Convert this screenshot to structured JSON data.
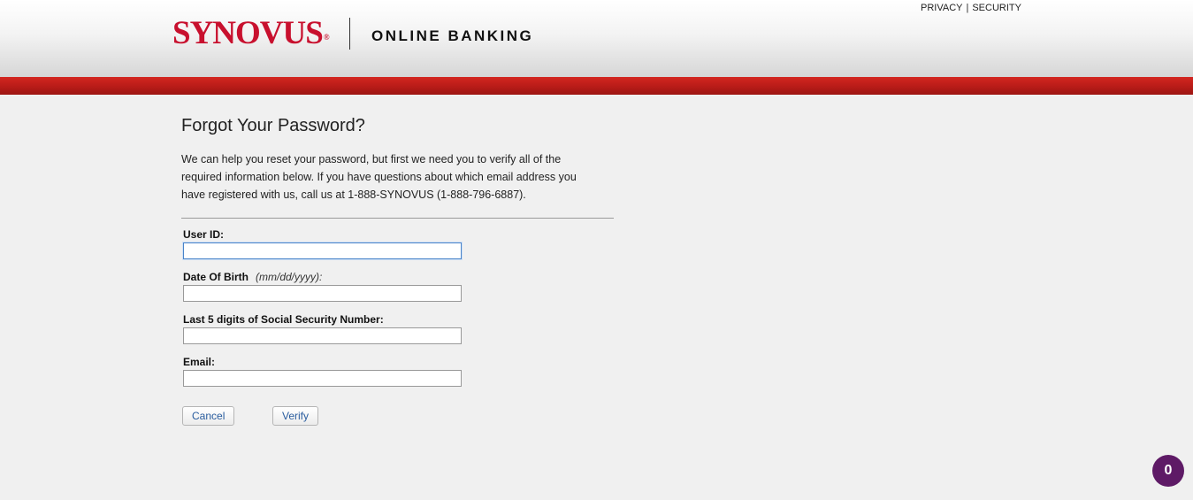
{
  "header": {
    "brand": "SYNOVUS",
    "brand_mark": "®",
    "product": "ONLINE BANKING",
    "links": {
      "privacy": "PRIVACY",
      "separator": "|",
      "security": "SECURITY"
    }
  },
  "colors": {
    "brand_red": "#c8102e",
    "bar_red": "#b81c18",
    "button_text": "#2a5d9f",
    "badge": "#5e1a66"
  },
  "form": {
    "title": "Forgot Your Password?",
    "intro": "We can help you reset your password, but first we need you to verify all of the required information below. If you have questions about which email address you have registered with us, call us at 1-888-SYNOVUS (1-888-796-6887).",
    "fields": {
      "user_id": {
        "label": "User ID:",
        "value": "",
        "placeholder": ""
      },
      "dob": {
        "label": "Date Of Birth",
        "hint": "(mm/dd/yyyy):",
        "value": "",
        "placeholder": ""
      },
      "ssn": {
        "label": "Last 5 digits of Social Security Number:",
        "value": "",
        "placeholder": ""
      },
      "email": {
        "label": "Email:",
        "value": "",
        "placeholder": ""
      }
    },
    "buttons": {
      "cancel": "Cancel",
      "verify": "Verify"
    }
  },
  "badge": {
    "count": "0"
  }
}
